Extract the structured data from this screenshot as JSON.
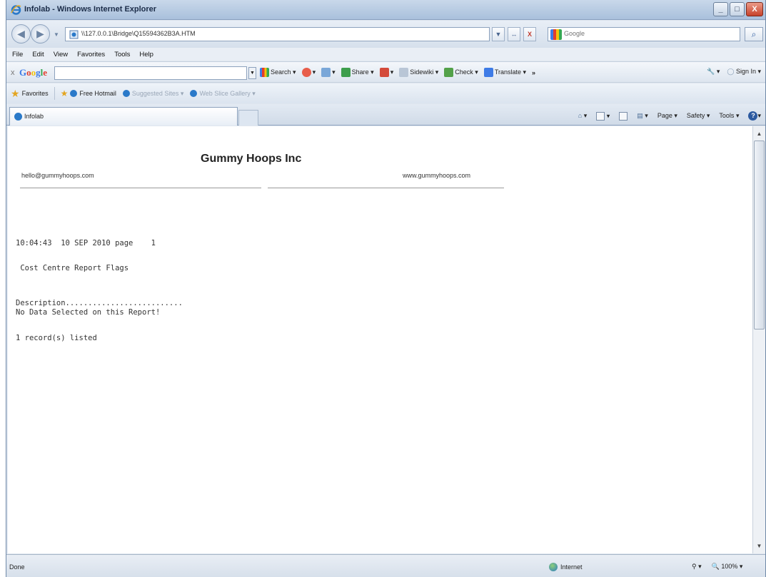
{
  "window": {
    "title": "Infolab - Windows Internet Explorer",
    "minimize_label": "_",
    "maximize_label": "□",
    "close_label": "X"
  },
  "address_bar": {
    "url": "\\\\127.0.0.1\\Bridge\\Q15594362B3A.HTM",
    "search_placeholder": "Google",
    "go_label": "↔",
    "stop_label": "X",
    "search_icon": "magnifier-icon"
  },
  "menu": [
    "File",
    "Edit",
    "View",
    "Favorites",
    "Tools",
    "Help"
  ],
  "google_toolbar": {
    "close": "x",
    "logo": "Google",
    "search_label": "Search",
    "share_label": "Share",
    "sidewiki_label": "Sidewiki",
    "check_label": "Check",
    "translate_label": "Translate",
    "more_label": "»",
    "sign_in_label": "Sign In"
  },
  "favorites_bar": {
    "favorites_label": "Favorites",
    "items": [
      "Free Hotmail",
      "Suggested Sites",
      "Web Slice Gallery"
    ]
  },
  "tab": {
    "label": "Infolab"
  },
  "command_bar": {
    "page_label": "Page",
    "safety_label": "Safety",
    "tools_label": "Tools",
    "help_label": "?"
  },
  "report": {
    "company": "Gummy Hoops Inc",
    "email": "hello@gummyhoops.com",
    "website": "www.gummyhoops.com",
    "timestamp_line": "10:04:43  10 SEP 2010 page    1",
    "report_title": " Cost Centre Report Flags",
    "description_header": "Description..........................",
    "no_data_line": "No Data Selected on this Report!",
    "records_line": "1 record(s) listed"
  },
  "status_bar": {
    "status": "Done",
    "zone": "Internet",
    "protected": "⚲",
    "zoom": "100%"
  }
}
